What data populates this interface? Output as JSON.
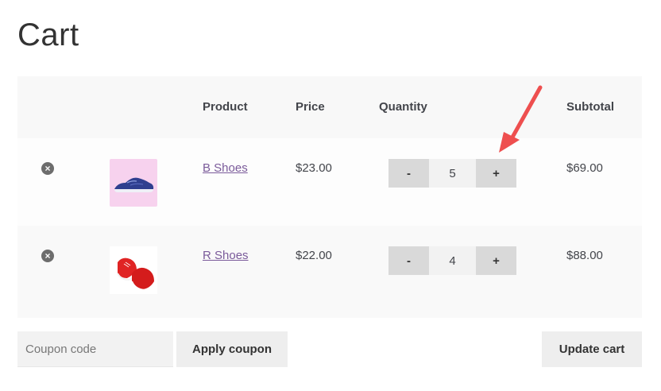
{
  "page": {
    "title": "Cart"
  },
  "table": {
    "headers": {
      "product": "Product",
      "price": "Price",
      "quantity": "Quantity",
      "subtotal": "Subtotal"
    }
  },
  "items": [
    {
      "remove_icon": "close-circle-icon",
      "image": "blue-shoe-image",
      "name": "B Shoes",
      "price": "$23.00",
      "quantity": "5",
      "minus": "-",
      "plus": "+",
      "subtotal": "$69.00"
    },
    {
      "remove_icon": "close-circle-icon",
      "image": "red-shoe-image",
      "name": "R Shoes",
      "price": "$22.00",
      "quantity": "4",
      "minus": "-",
      "plus": "+",
      "subtotal": "$88.00"
    }
  ],
  "actions": {
    "coupon_placeholder": "Coupon code",
    "apply_label": "Apply coupon",
    "update_label": "Update cart"
  },
  "colors": {
    "link": "#7a5a9a",
    "arrow": "#ee4f4f",
    "thumb_bg": "#f7d2ee"
  }
}
